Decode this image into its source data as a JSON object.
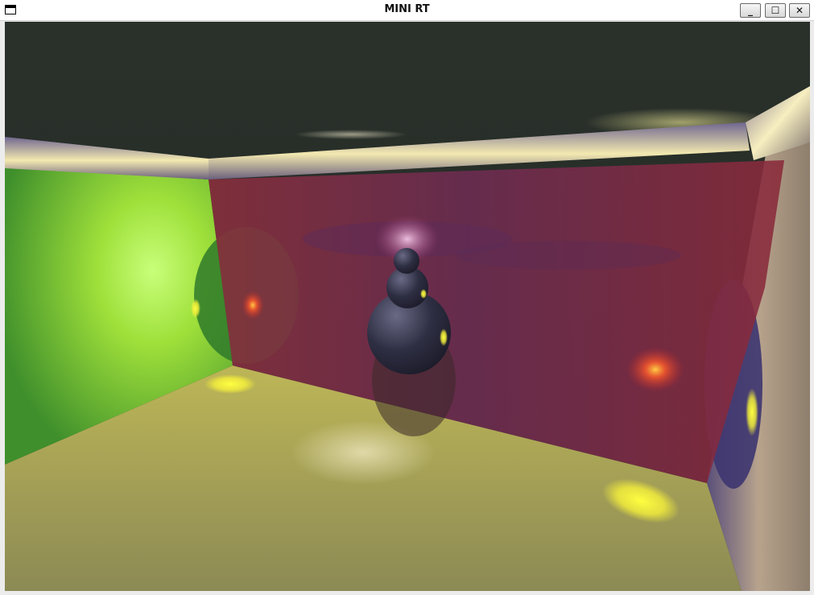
{
  "window": {
    "title": "MINI RT",
    "icon": "window-icon",
    "controls": {
      "minimize_glyph": "_",
      "maximize_glyph": "☐",
      "close_glyph": "✕"
    }
  },
  "render": {
    "colors": {
      "ceiling": "#2b322c",
      "left_wall": "#5fc22f",
      "back_wall": "#7a2a4a",
      "floor": "#b8b14f",
      "right_wall": "#c4b08e",
      "cylinder_metal": "#b8a88a"
    }
  }
}
